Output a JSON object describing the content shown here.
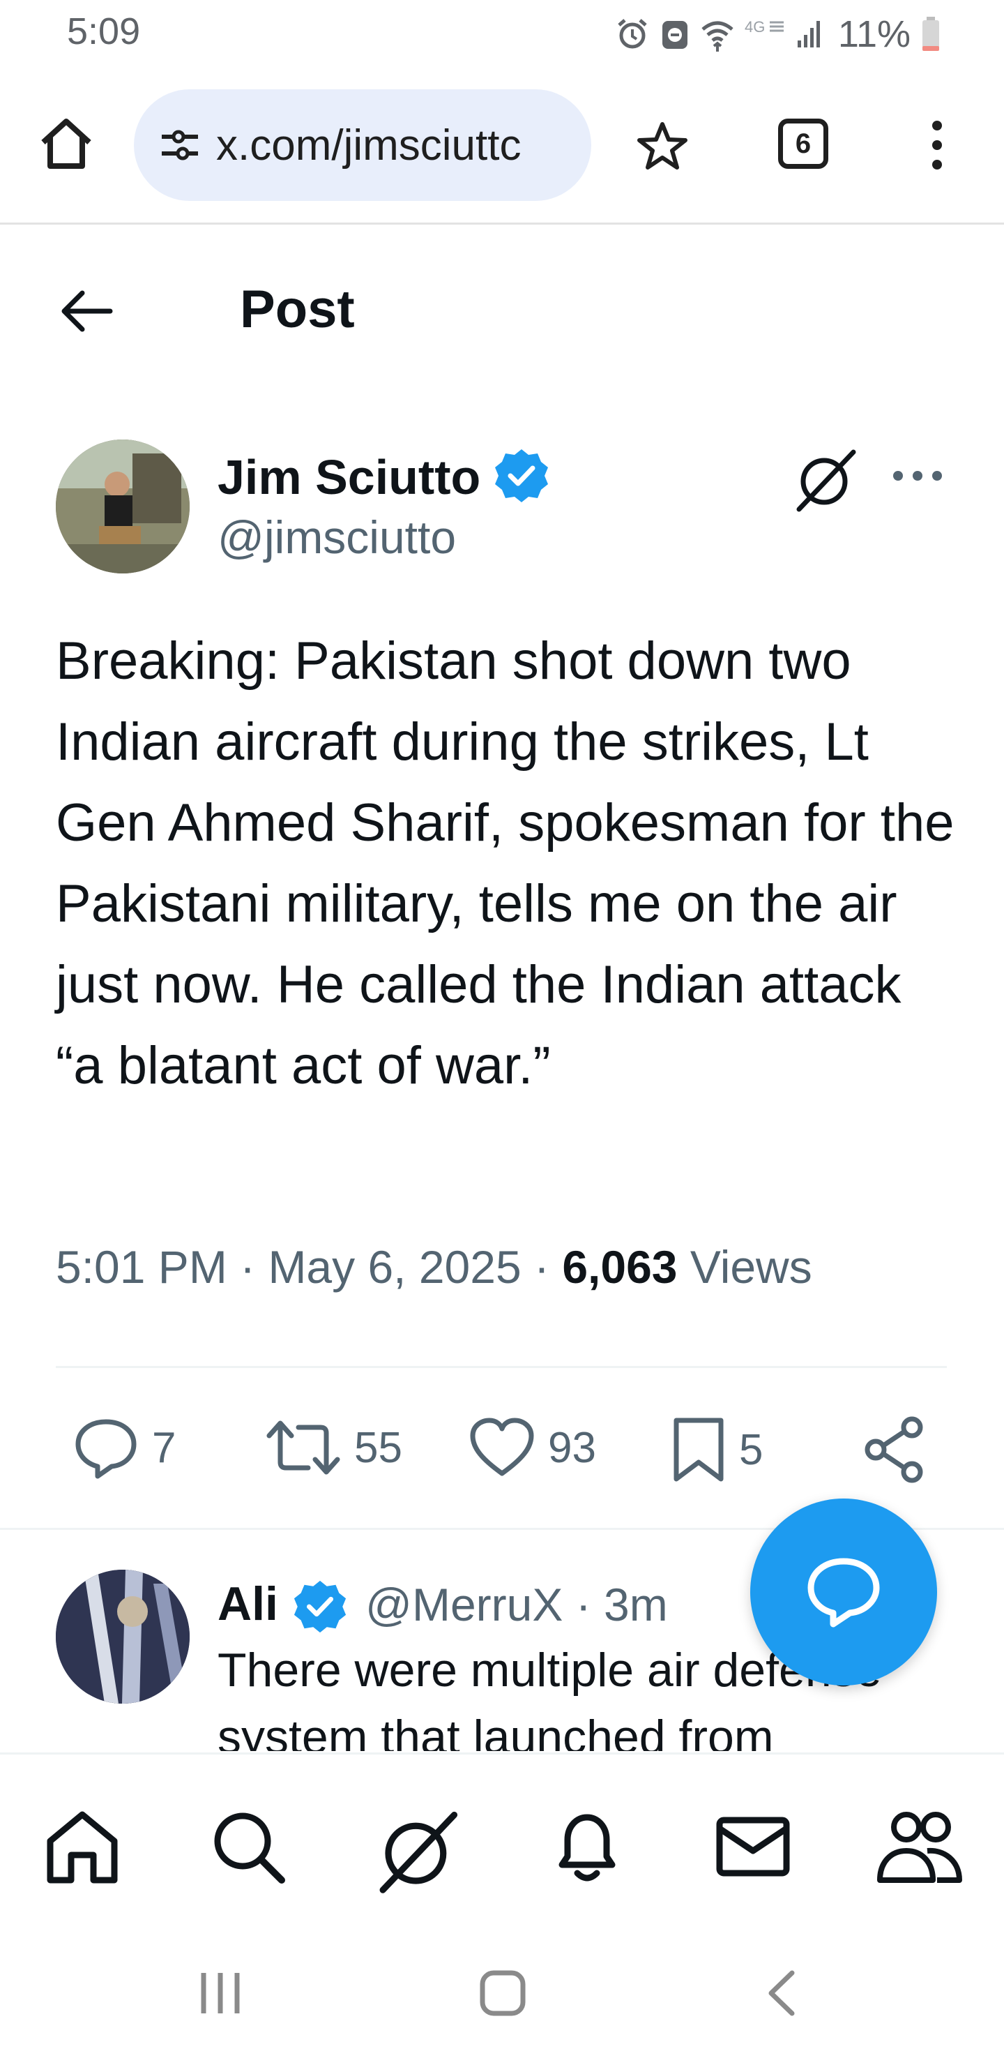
{
  "status_bar": {
    "time": "5:09",
    "battery": "11%",
    "icons": [
      "alarm-icon",
      "dnd-icon",
      "wifi-icon",
      "4g-icon",
      "signal-icon",
      "battery-icon"
    ]
  },
  "browser": {
    "url": "x.com/jimsciuttc",
    "tab_count": "6",
    "icons": [
      "home-icon",
      "site-settings-icon",
      "bookmark-star-icon",
      "tabs-icon",
      "menu-icon"
    ]
  },
  "header": {
    "title": "Post"
  },
  "post": {
    "author_name": "Jim Sciutto",
    "author_handle": "@jimsciutto",
    "verified": true,
    "text": "Breaking: Pakistan shot down two Indian aircraft during the strikes, Lt Gen Ahmed Sharif, spokesman for the Pakistani military, tells me on the air just now. He called the Indian attack “a blatant act of war.”",
    "time": "5:01 PM",
    "date": "May 6, 2025",
    "views_count": "6,063",
    "views_label": "Views",
    "replies": "7",
    "reposts": "55",
    "likes": "93",
    "bookmarks": "5"
  },
  "reply": {
    "name": "Ali",
    "handle_time": "@MerruX · 3m",
    "text": "There were multiple air defense system that launched from"
  },
  "colors": {
    "accent": "#1d9bf0",
    "text_primary": "#0f1419",
    "text_secondary": "#536471"
  }
}
